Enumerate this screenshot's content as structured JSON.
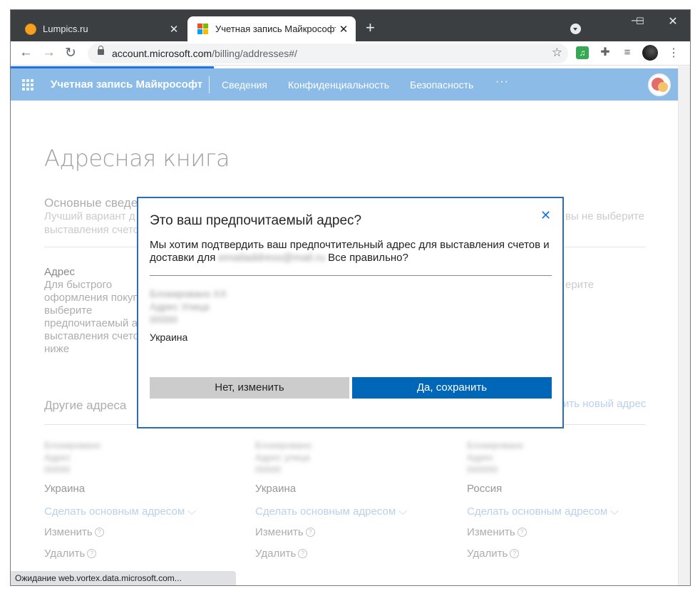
{
  "browser": {
    "tabs": [
      {
        "title": "Lumpics.ru",
        "close": "✕"
      },
      {
        "title": "Учетная запись Майкрософт | А",
        "close": "✕"
      }
    ],
    "new_tab": "+",
    "window_controls": {
      "minimize": "—",
      "maximize": "☐",
      "close": "✕"
    },
    "nav": {
      "back": "←",
      "forward": "→",
      "reload": "↻"
    },
    "url_host": "account.microsoft.com",
    "url_path": "/billing/addresses#/",
    "star": "☆",
    "menu": "⋮",
    "extensions": {
      "music": "♫",
      "puzzle": "✚",
      "queue": "≡"
    },
    "status": "Ожидание web.vortex.data.microsoft.com..."
  },
  "header": {
    "brand": "Учетная запись Майкрософт",
    "nav": [
      "Сведения",
      "Конфиденциальность",
      "Безопасность"
    ],
    "more": "···"
  },
  "page": {
    "title": "Адресная книга",
    "basic_heading": "Основные сведе",
    "basic_line1": "Лучший вариант д",
    "basic_line2": "выставления счето",
    "basic_right": "вы не выберите",
    "address_heading": "Адрес",
    "address_lines": [
      "Для быстрого",
      "оформления покуп",
      "выберите",
      "предпочитаемый а",
      "выставления счето",
      "ниже"
    ],
    "address_right": "ерите",
    "other_heading": "Другие адреса",
    "add_new": "ить новый адрес",
    "addresses": [
      {
        "line1": "Блокировано",
        "line2": "Адрес",
        "line3": "00000",
        "country": "Украина"
      },
      {
        "line1": "Блокировано",
        "line2": "Адрес улица",
        "line3": "00000",
        "country": "Украина"
      },
      {
        "line1": "Блокировано",
        "line2": "Адрес",
        "line3": "000000",
        "country": "Россия"
      }
    ],
    "make_primary": "Сделать основным адресом",
    "edit": "Изменить",
    "delete": "Удалить"
  },
  "dialog": {
    "title": "Это ваш предпочитаемый адрес?",
    "close": "✕",
    "text_before": "Мы хотим подтвердить ваш предпочтительный адрес для выставления счетов и доставки для",
    "email": "emailaddress@mail.ru",
    "text_after": "Все правильно?",
    "addr_line1": "Блокировано ХХ",
    "addr_line2": "Адрес Улица",
    "addr_line3": "00000",
    "country": "Украина",
    "no_button": "Нет, изменить",
    "yes_button": "Да, сохранить"
  }
}
